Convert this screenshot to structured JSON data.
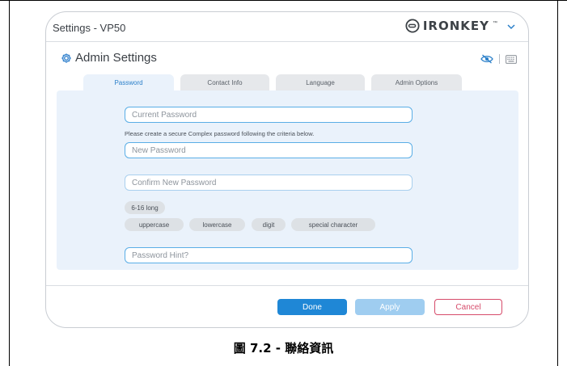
{
  "window": {
    "title": "Settings - VP50",
    "brand": "IRONKEY",
    "brand_tm": "™"
  },
  "section": {
    "title": "Admin Settings"
  },
  "tabs": [
    {
      "label": "Password",
      "active": true
    },
    {
      "label": "Contact Info",
      "active": false
    },
    {
      "label": "Language",
      "active": false
    },
    {
      "label": "Admin Options",
      "active": false
    }
  ],
  "form": {
    "current_password_placeholder": "Current Password",
    "criteria_text": "Please create a secure Complex password following the criteria below.",
    "new_password_placeholder": "New Password",
    "confirm_password_placeholder": "Confirm New Password",
    "criteria_chips": [
      "6-16 long",
      "uppercase",
      "lowercase",
      "digit",
      "special character"
    ],
    "hint_placeholder": "Password Hint?"
  },
  "buttons": {
    "done": "Done",
    "apply": "Apply",
    "cancel": "Cancel"
  },
  "caption": "圖 7.2 - 聯絡資訊",
  "icons": [
    "ironkey-logo-icon",
    "chevron-down-icon",
    "gear-icon",
    "eye-hidden-icon",
    "keyboard-icon"
  ],
  "colors": {
    "accent": "#1f87d6",
    "accent_light": "#9fcdf0",
    "cancel": "#d64b6a",
    "panel_bg": "#eaf2fb"
  }
}
